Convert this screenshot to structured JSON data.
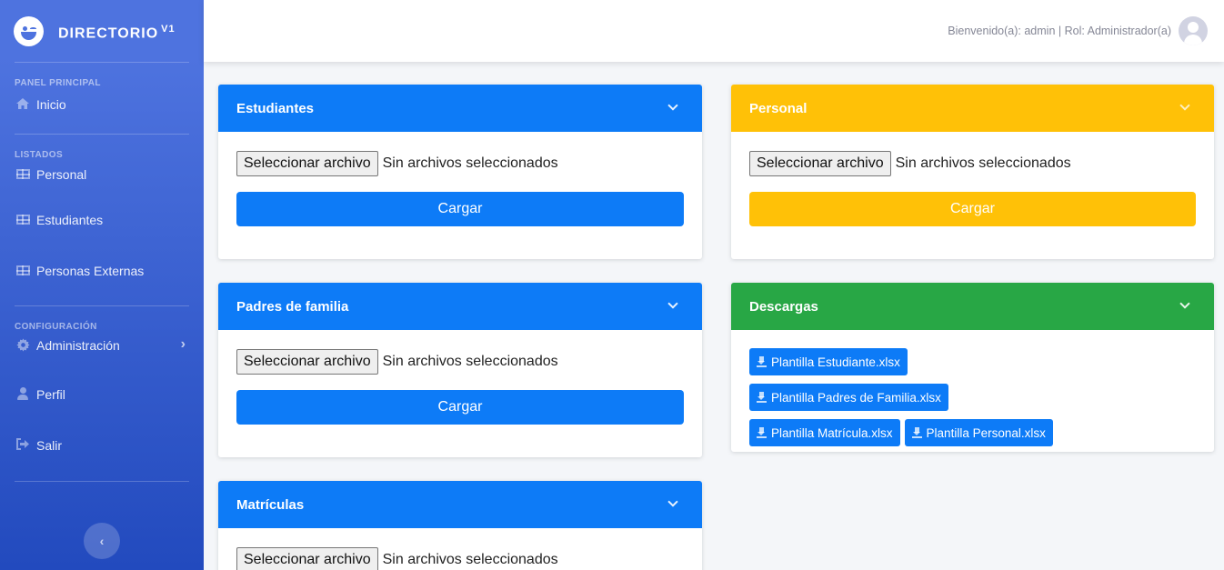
{
  "brand": {
    "name": "DIRECTORIO",
    "version": "V1"
  },
  "sidebar": {
    "sections": [
      {
        "heading": "PANEL PRINCIPAL"
      },
      {
        "heading": "LISTADOS"
      },
      {
        "heading": "CONFIGURACIÓN"
      }
    ],
    "items": [
      {
        "label": "Inicio",
        "icon": "home-icon"
      },
      {
        "label": "Personal",
        "icon": "table-icon"
      },
      {
        "label": "Estudiantes",
        "icon": "table-icon"
      },
      {
        "label": "Personas Externas",
        "icon": "table-icon"
      },
      {
        "label": "Administración",
        "icon": "gear-icon"
      },
      {
        "label": "Perfil",
        "icon": "user-icon"
      },
      {
        "label": "Salir",
        "icon": "sign-out-icon"
      }
    ],
    "toggle_icon": "chevron-left-icon"
  },
  "topbar": {
    "welcome": "Bienvenido(a): admin | Rol: Administrador(a)"
  },
  "file_input": {
    "button": "Seleccionar archivo",
    "status": "Sin archivos seleccionados"
  },
  "cards": {
    "estudiantes": {
      "title": "Estudiantes",
      "submit": "Cargar",
      "color": "#0d7bf7"
    },
    "padres": {
      "title": "Padres de familia",
      "submit": "Cargar",
      "color": "#0d7bf7"
    },
    "matriculas": {
      "title": "Matrículas",
      "color": "#0d7bf7"
    },
    "personal": {
      "title": "Personal",
      "submit": "Cargar",
      "color": "#ffc107"
    },
    "descargas": {
      "title": "Descargas",
      "color": "#28a745",
      "downloads": [
        "Plantilla Estudiante.xlsx",
        "Plantilla Padres de Familia.xlsx",
        "Plantilla Matrícula.xlsx",
        "Plantilla Personal.xlsx"
      ]
    }
  }
}
